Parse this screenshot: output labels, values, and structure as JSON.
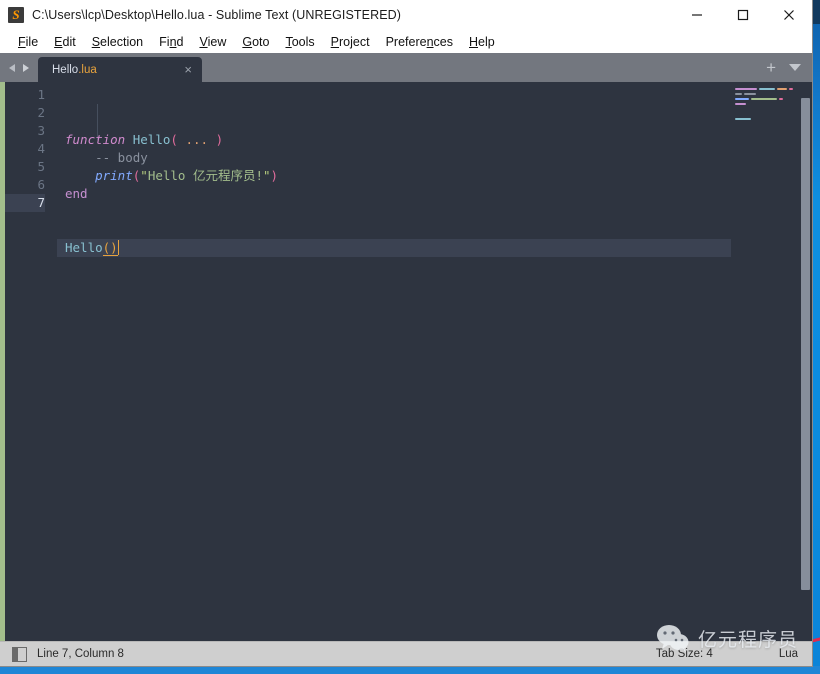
{
  "window": {
    "title": "C:\\Users\\lcp\\Desktop\\Hello.lua - Sublime Text (UNREGISTERED)",
    "app_icon": "sublime-text-logo-icon",
    "controls": {
      "minimize": "minimize-icon",
      "maximize": "maximize-icon",
      "close": "close-icon"
    }
  },
  "menu": {
    "items": [
      {
        "label": "File",
        "mnemonic": "F"
      },
      {
        "label": "Edit",
        "mnemonic": "E"
      },
      {
        "label": "Selection",
        "mnemonic": "S"
      },
      {
        "label": "Find",
        "mnemonic": "n"
      },
      {
        "label": "View",
        "mnemonic": "V"
      },
      {
        "label": "Goto",
        "mnemonic": "G"
      },
      {
        "label": "Tools",
        "mnemonic": "T"
      },
      {
        "label": "Project",
        "mnemonic": "P"
      },
      {
        "label": "Preferences",
        "mnemonic": "n"
      },
      {
        "label": "Help",
        "mnemonic": "H"
      }
    ]
  },
  "tab_bar": {
    "prev_icon": "chevron-left-icon",
    "next_icon": "chevron-right-icon",
    "tabs": [
      {
        "name": "Hello",
        "ext": ".lua",
        "close_icon": "close-icon",
        "active": true
      }
    ],
    "new_tab_icon": "plus-icon",
    "tab_menu_icon": "chevron-down-icon"
  },
  "editor": {
    "line_numbers": [
      "1",
      "2",
      "3",
      "4",
      "5",
      "6",
      "7"
    ],
    "active_line": 7,
    "lines": [
      {
        "n": "1",
        "tokens": [
          {
            "t": "function",
            "c": "tok-kw"
          },
          {
            "t": " ",
            "c": ""
          },
          {
            "t": "Hello",
            "c": "tok-fn"
          },
          {
            "t": "(",
            "c": "tok-paren"
          },
          {
            "t": " ",
            "c": ""
          },
          {
            "t": "...",
            "c": "tok-vararg"
          },
          {
            "t": " ",
            "c": ""
          },
          {
            "t": ")",
            "c": "tok-paren"
          }
        ]
      },
      {
        "n": "2",
        "tokens": [
          {
            "t": "    ",
            "c": ""
          },
          {
            "t": "-- body",
            "c": "tok-comment"
          }
        ]
      },
      {
        "n": "3",
        "tokens": [
          {
            "t": "    ",
            "c": ""
          },
          {
            "t": "print",
            "c": "tok-builtin"
          },
          {
            "t": "(",
            "c": "tok-paren"
          },
          {
            "t": "\"",
            "c": "tok-str-q"
          },
          {
            "t": "Hello 亿元程序员!",
            "c": "tok-str"
          },
          {
            "t": "\"",
            "c": "tok-str-q"
          },
          {
            "t": ")",
            "c": "tok-paren"
          }
        ]
      },
      {
        "n": "4",
        "tokens": [
          {
            "t": "end",
            "c": "tok-kw-plain"
          }
        ]
      },
      {
        "n": "5",
        "tokens": []
      },
      {
        "n": "6",
        "tokens": []
      },
      {
        "n": "7",
        "tokens": [
          {
            "t": "Hello",
            "c": "tok-fn"
          },
          {
            "t": "()",
            "c": "tok-bracket-match"
          }
        ]
      }
    ],
    "caret": {
      "line": 7,
      "column": 8
    },
    "minimap": [
      [
        {
          "w": 22,
          "color": "#c58fd0"
        },
        {
          "w": 16,
          "color": "#88c0d0"
        },
        {
          "w": 10,
          "color": "#e0a070"
        },
        {
          "w": 4,
          "color": "#e06c9c"
        }
      ],
      [
        {
          "w": 7,
          "color": "#8a919e"
        },
        {
          "w": 12,
          "color": "#8a919e"
        }
      ],
      [
        {
          "w": 14,
          "color": "#82aaff"
        },
        {
          "w": 26,
          "color": "#a3be8c"
        },
        {
          "w": 4,
          "color": "#e06c9c"
        }
      ],
      [
        {
          "w": 11,
          "color": "#c58fd0"
        }
      ],
      [],
      [],
      [
        {
          "w": 16,
          "color": "#88c0d0"
        }
      ]
    ]
  },
  "status_bar": {
    "sidebar_icon": "sidebar-toggle-icon",
    "position": "Line 7, Column 8",
    "tab_size": "Tab Size: 4",
    "syntax": "Lua"
  },
  "watermark": {
    "icon": "wechat-logo-icon",
    "text": "亿元程序员"
  },
  "colors": {
    "desktop": "#0b8ade",
    "editor_bg": "#2e3440",
    "active_line": "#3b4252",
    "tab_bar": "#73777f",
    "modified_strip": "#a3be8c",
    "accent_orange": "#e8a33d",
    "status_bar": "#cfcfcf"
  }
}
